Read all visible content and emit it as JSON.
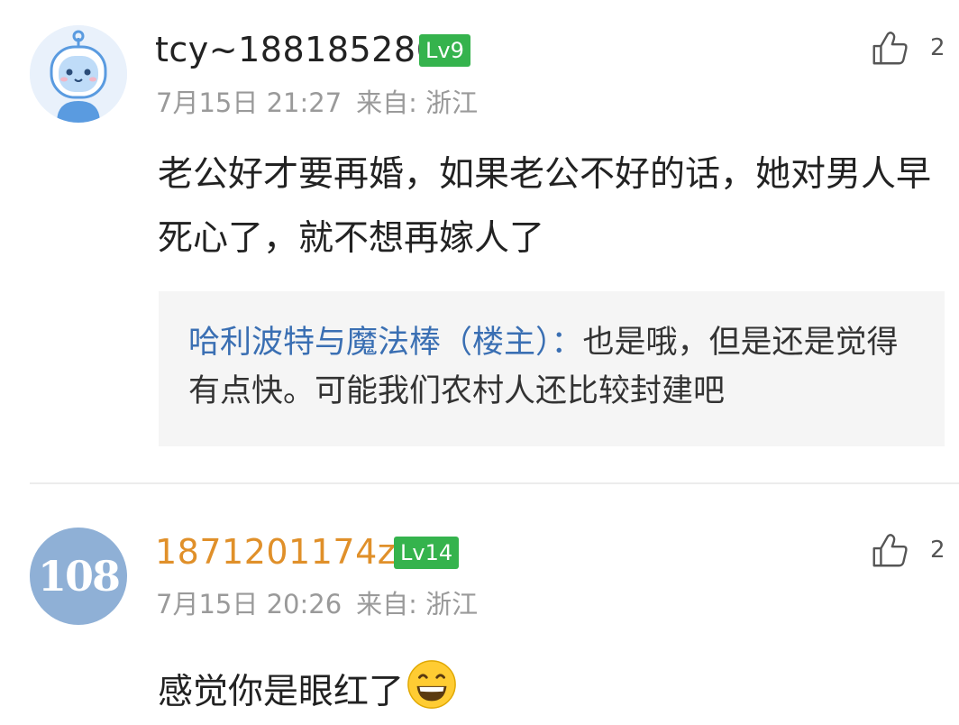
{
  "comments": [
    {
      "username": "tcy~188185286",
      "level": "Lv9",
      "date": "7月15日 21:27",
      "location": "来自: 浙江",
      "likes": "2",
      "text": "老公好才要再婚，如果老公不好的话，她对男人早死心了，就不想再嫁人了",
      "reply": {
        "author": "哈利波特与魔法棒（楼主）：",
        "text": "也是哦，但是还是觉得有点快。可能我们农村人还比较封建吧"
      }
    },
    {
      "username": "1871201174zh",
      "level": "Lv14",
      "date": "7月15日 20:26",
      "location": "来自: 浙江",
      "likes": "2",
      "avatar_text": "108",
      "text": "感觉你是眼红了"
    }
  ],
  "icons": {
    "like": "thumbs-up-icon",
    "emoji": "grinning-face-icon"
  },
  "colors": {
    "level_badge": "#35b34d",
    "username_highlight": "#e0902a",
    "reply_author": "#3a6fb3",
    "meta_gray": "#9a9a9a"
  }
}
